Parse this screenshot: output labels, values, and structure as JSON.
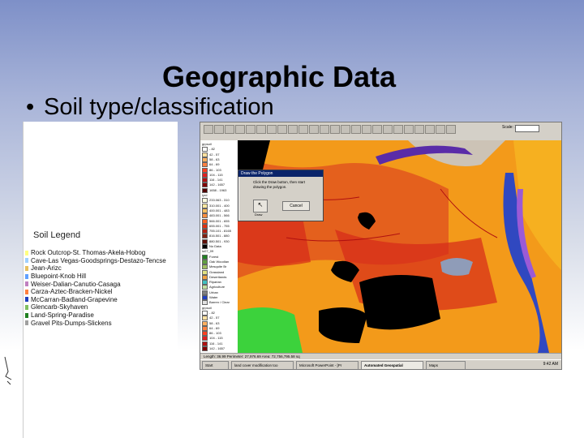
{
  "slide": {
    "title": "Geographic Data",
    "bullet": "Soil type/classification",
    "bullet_symbol": "•"
  },
  "legend": {
    "title": "Soil Legend",
    "items": [
      {
        "label": "Rock Outcrop-St. Thomas-Akela-Hobog",
        "color": "#ffff80"
      },
      {
        "label": "Cave-Las Vegas-Goodsprings-Destazo-Tencse",
        "color": "#a0d0ff"
      },
      {
        "label": "Jean-Arizc",
        "color": "#e8c060"
      },
      {
        "label": "Bluepoint-Knob Hill",
        "color": "#60a0ff"
      },
      {
        "label": "Weiser-Dalian-Canutio-Casaga",
        "color": "#c080c0"
      },
      {
        "label": "Carza-Aztec-Bracken-Nickel",
        "color": "#ff8040"
      },
      {
        "label": "McCarran-Badland-Grapevine",
        "color": "#2040c0"
      },
      {
        "label": "Glencarb-Skyhaven",
        "color": "#80c060"
      },
      {
        "label": "Land-Spring-Paradise",
        "color": "#208020"
      },
      {
        "label": "Gravel Pits-Dumps-Slickens",
        "color": "#a0a0a0"
      }
    ]
  },
  "gis": {
    "scale_label": "Scale: 1:",
    "dialog": {
      "title": "Draw the Polygon",
      "text": "Click the Draw button, then start drawing the polygon.",
      "draw_label": "Draw",
      "cancel_label": "Cancel"
    },
    "status": "Length: 36.99   Perimeter: 27,976.69   Area: 72,756,795.58 sq",
    "toc_items": [
      {
        "label": "grpsoil",
        "color": ""
      },
      {
        "label": "- 82",
        "color": "#ffffff"
      },
      {
        "label": "42 - 57",
        "color": "#ffe0a0"
      },
      {
        "label": "58 - 63",
        "color": "#ffb060"
      },
      {
        "label": "64 - 69",
        "color": "#ff8040"
      },
      {
        "label": "86 - 103",
        "color": "#ff4020"
      },
      {
        "label": "104 - 115",
        "color": "#e02020"
      },
      {
        "label": "116 - 141",
        "color": "#b01010"
      },
      {
        "label": "142 - 1657",
        "color": "#800000"
      },
      {
        "label": "1658 - 1963",
        "color": "#500000"
      },
      {
        "label": "lyrd",
        "color": ""
      },
      {
        "label": "233.063 - 310",
        "color": "#ffffe0"
      },
      {
        "label": "310.001 - 400",
        "color": "#ffe8a0"
      },
      {
        "label": "400.001 - 483",
        "color": "#ffc060"
      },
      {
        "label": "483.001 - 566",
        "color": "#ff9040"
      },
      {
        "label": "566.001 - 655",
        "color": "#ff6020"
      },
      {
        "label": "655.001 - 755",
        "color": "#e03010"
      },
      {
        "label": "755.101 - 8165",
        "color": "#b02010"
      },
      {
        "label": "816.501 - 880",
        "color": "#802010"
      },
      {
        "label": "880.501 - 930",
        "color": "#601008"
      },
      {
        "label": "No Data",
        "color": "#000000"
      },
      {
        "label": "lu07_09",
        "color": ""
      },
      {
        "label": "Forest",
        "color": "#208020"
      },
      {
        "label": "Oak Woodlan",
        "color": "#60a040"
      },
      {
        "label": "Mesquite Br",
        "color": "#a0c060"
      },
      {
        "label": "Grassland",
        "color": "#e0e080"
      },
      {
        "label": "Desertlands",
        "color": "#f0a040"
      },
      {
        "label": "Riparian",
        "color": "#40c0c0"
      },
      {
        "label": "Agriculture",
        "color": "#c0e0a0"
      },
      {
        "label": "Urban",
        "color": "#808080"
      },
      {
        "label": "Water",
        "color": "#2040c0"
      },
      {
        "label": "Barren / Clear",
        "color": "#e0e0e0"
      },
      {
        "label": "grpsoil",
        "color": ""
      },
      {
        "label": "- 82",
        "color": "#ffffff"
      },
      {
        "label": "42 - 57",
        "color": "#ffe0a0"
      },
      {
        "label": "58 - 63",
        "color": "#ffb060"
      },
      {
        "label": "64 - 69",
        "color": "#ff8040"
      },
      {
        "label": "86 - 103",
        "color": "#ff4020"
      },
      {
        "label": "104 - 115",
        "color": "#e02020"
      },
      {
        "label": "116 - 141",
        "color": "#b01010"
      },
      {
        "label": "142 - 1657",
        "color": "#800000"
      }
    ],
    "taskbar": [
      {
        "label": "Start",
        "active": false
      },
      {
        "label": "land cover modification too",
        "active": false
      },
      {
        "label": "Microsoft PowerPoint - [Pr",
        "active": false
      },
      {
        "label": "Automated Geospatial",
        "active": true
      },
      {
        "label": "Maps",
        "active": false
      }
    ],
    "clock": "9:42 AM"
  },
  "colors": {
    "map_orange": "#f39a1a",
    "map_red": "#d62a1a",
    "water_purple": "#5a2ca8",
    "water_blue": "#3048c0",
    "nodata_black": "#000000",
    "grass_green": "#3cd23c"
  }
}
